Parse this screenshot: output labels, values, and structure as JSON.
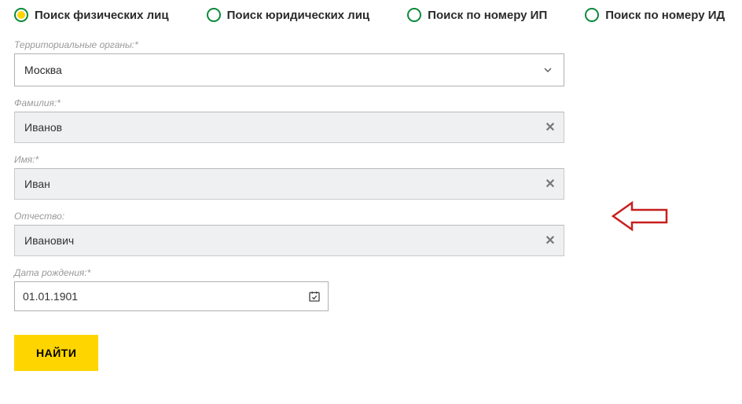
{
  "tabs": [
    {
      "label": "Поиск физических лиц",
      "selected": true
    },
    {
      "label": "Поиск юридических лиц",
      "selected": false
    },
    {
      "label": "Поиск по номеру ИП",
      "selected": false
    },
    {
      "label": "Поиск по номеру ИД",
      "selected": false
    }
  ],
  "fields": {
    "territory": {
      "label": "Территориальные органы:*",
      "value": "Москва"
    },
    "lastname": {
      "label": "Фамилия:*",
      "value": "Иванов"
    },
    "firstname": {
      "label": "Имя:*",
      "value": "Иван"
    },
    "patronymic": {
      "label": "Отчество:",
      "value": "Иванович"
    },
    "birthdate": {
      "label": "Дата рождения:*",
      "value": "01.01.1901"
    }
  },
  "submit": {
    "label": "НАЙТИ"
  }
}
